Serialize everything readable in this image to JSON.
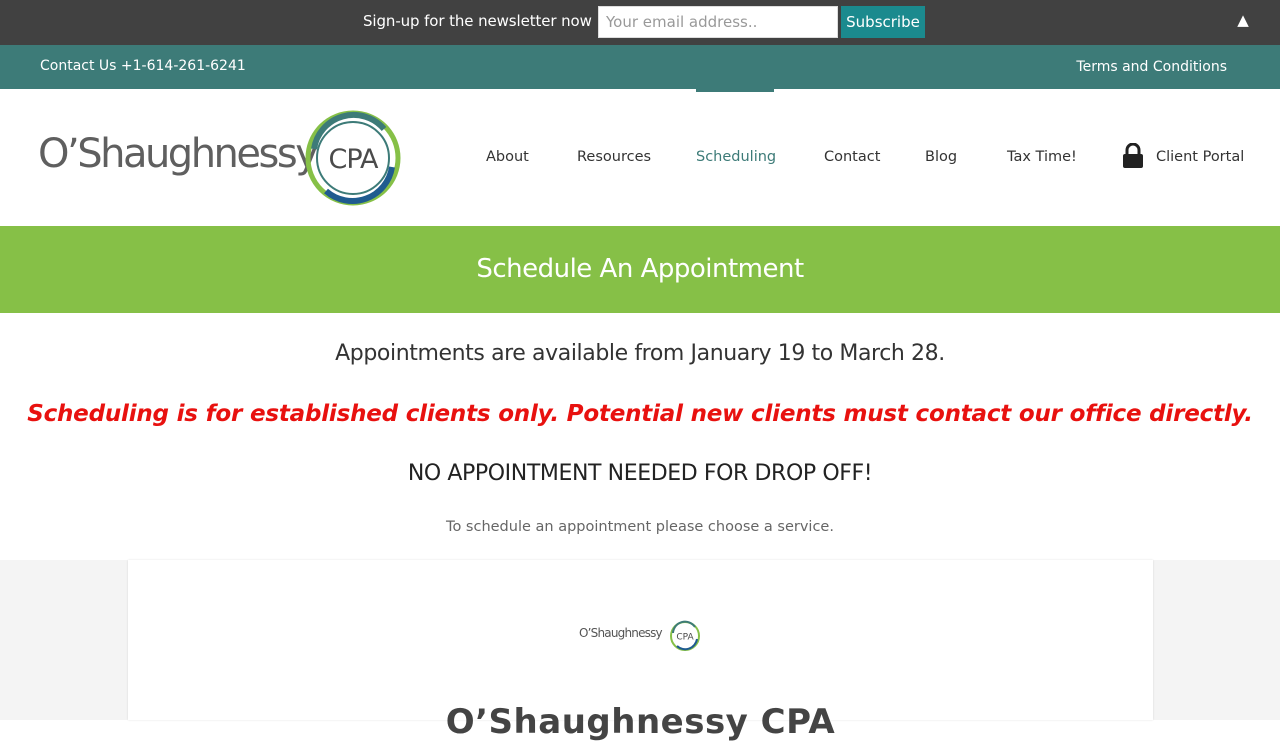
{
  "newsletter": {
    "label": "Sign-up for the newsletter now",
    "email_placeholder": "Your email address..",
    "subscribe_label": "Subscribe",
    "collapse_icon": "▲"
  },
  "topbar": {
    "contact": "Contact Us +1-614-261-6241",
    "terms": "Terms and Conditions"
  },
  "logo": {
    "name": "O’Shaughnessy",
    "badge": "CPA"
  },
  "nav": {
    "items": [
      "About",
      "Resources",
      "Scheduling",
      "Contact",
      "Blog",
      "Tax Time!",
      "Client Portal"
    ],
    "active": "Scheduling",
    "accent_color": "#3d7b78"
  },
  "banner": {
    "title": "Schedule An Appointment",
    "color": "#86c047"
  },
  "notice": {
    "availability": "Appointments are available from January 19 to March 28.",
    "warning": "Scheduling is for established clients only.  Potential new clients must contact our office directly.",
    "drop_off": "NO APPOINTMENT NEEDED FOR DROP OFF!",
    "instruction": "To schedule an appointment please choose a service."
  },
  "scheduler": {
    "logo_name": "O’Shaughnessy",
    "logo_badge": "CPA",
    "title": "O’Shaughnessy CPA"
  }
}
